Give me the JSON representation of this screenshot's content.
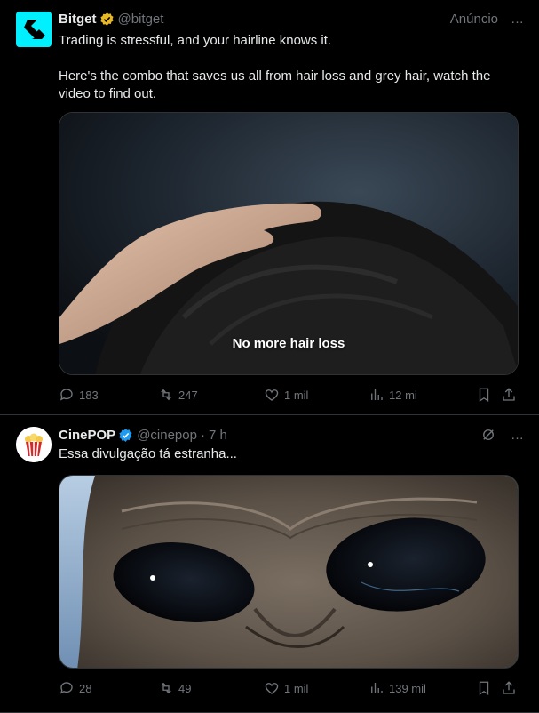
{
  "tweets": [
    {
      "name": "Bitget",
      "handle": "@bitget",
      "ad_label": "Anúncio",
      "text": "Trading is stressful, and your hairline knows it.\n\nHere's the combo that saves us all from hair loss and grey hair, watch the video to find out.",
      "media_caption": "No more hair loss",
      "replies": "183",
      "reposts": "247",
      "likes": "1 mil",
      "views": "12 mi",
      "avatar_color": "#00f0ff",
      "badge_color": "#e8b923"
    },
    {
      "name": "CinePOP",
      "handle": "@cinepop",
      "dot": "·",
      "time": "7 h",
      "text": "Essa divulgação tá estranha...",
      "replies": "28",
      "reposts": "49",
      "likes": "1 mil",
      "views": "139 mil",
      "badge_color": "#1d9bf0"
    }
  ],
  "icons": {
    "more": "…",
    "reply": "reply-icon",
    "repost": "repost-icon",
    "like": "like-icon",
    "views": "views-icon",
    "bookmark": "bookmark-icon",
    "share": "share-icon",
    "grok": "grok-icon"
  }
}
